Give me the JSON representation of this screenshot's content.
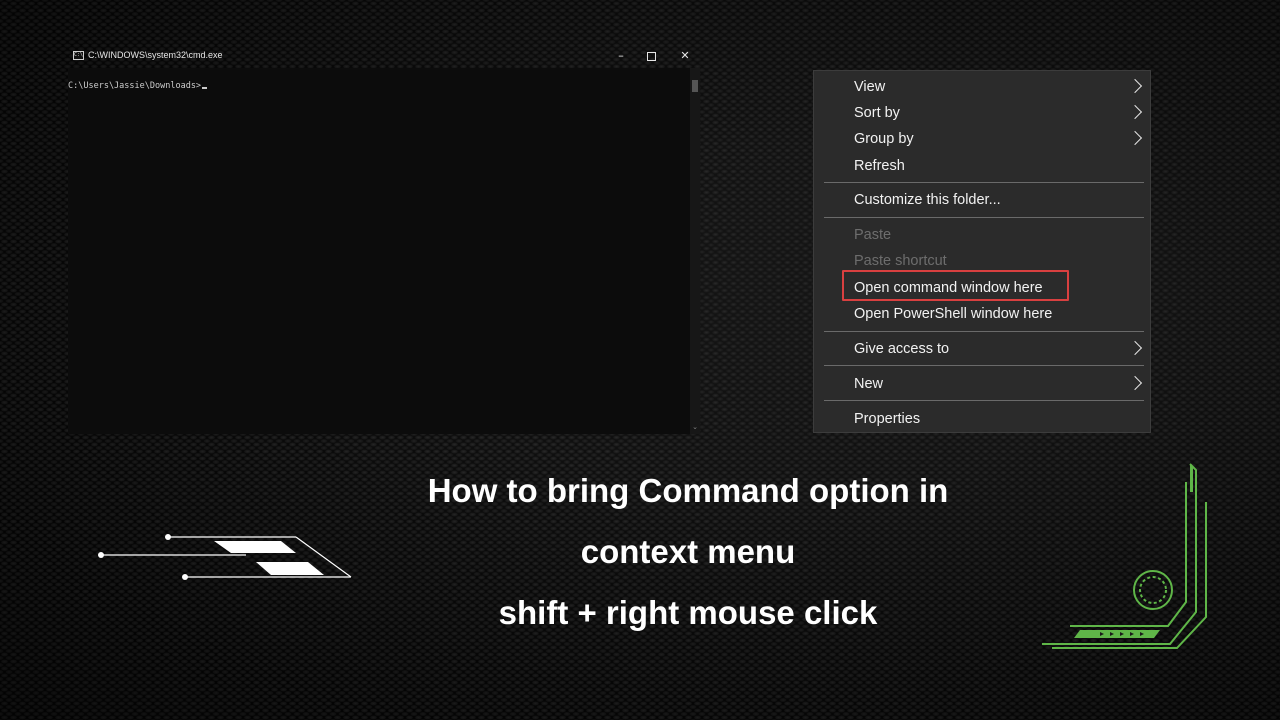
{
  "cmd_window": {
    "title": "C:\\WINDOWS\\system32\\cmd.exe",
    "icon": "cmd-app-icon",
    "icon_text": "C:\\",
    "prompt": "C:\\Users\\Jassie\\Downloads>",
    "minimize_glyph": "–",
    "close_glyph": "✕",
    "scroll_down_glyph": "⌄"
  },
  "context_menu": {
    "items": [
      {
        "label": "View",
        "has_submenu": true
      },
      {
        "label": "Sort by",
        "has_submenu": true
      },
      {
        "label": "Group by",
        "has_submenu": true
      },
      {
        "label": "Refresh"
      },
      {
        "label": "Customize this folder..."
      },
      {
        "label": "Paste",
        "disabled": true
      },
      {
        "label": "Paste shortcut",
        "disabled": true
      },
      {
        "label": "Open command window here",
        "highlighted": true
      },
      {
        "label": "Open PowerShell window here"
      },
      {
        "label": "Give access to",
        "has_submenu": true
      },
      {
        "label": "New",
        "has_submenu": true
      },
      {
        "label": "Properties"
      }
    ],
    "highlight_color": "#d94040"
  },
  "caption": {
    "line1": "How to bring Command option in",
    "line2": "context menu",
    "line3": "shift + right mouse click"
  },
  "colors": {
    "accent_green": "#5fb648",
    "menu_bg": "#2b2b2b",
    "console_bg": "#0c0c0c"
  }
}
